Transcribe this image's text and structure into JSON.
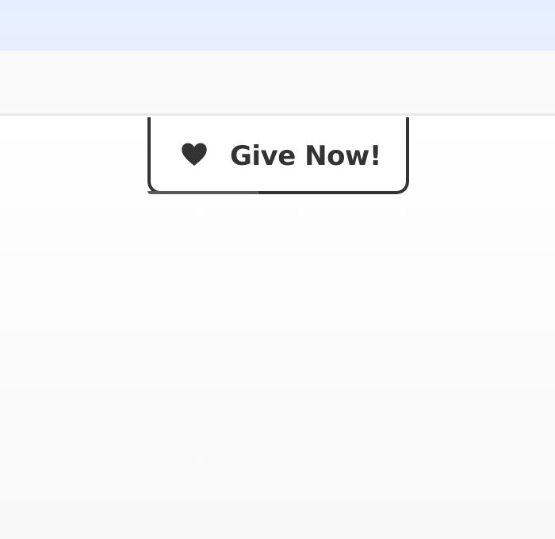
{
  "donation": {
    "button_label": "Give Now!",
    "icon": "heart-icon"
  },
  "colors": {
    "top_strip": "#e5efff",
    "toolbar_band": "#f9f9f9",
    "button_border": "#333333",
    "button_text": "#333333"
  }
}
